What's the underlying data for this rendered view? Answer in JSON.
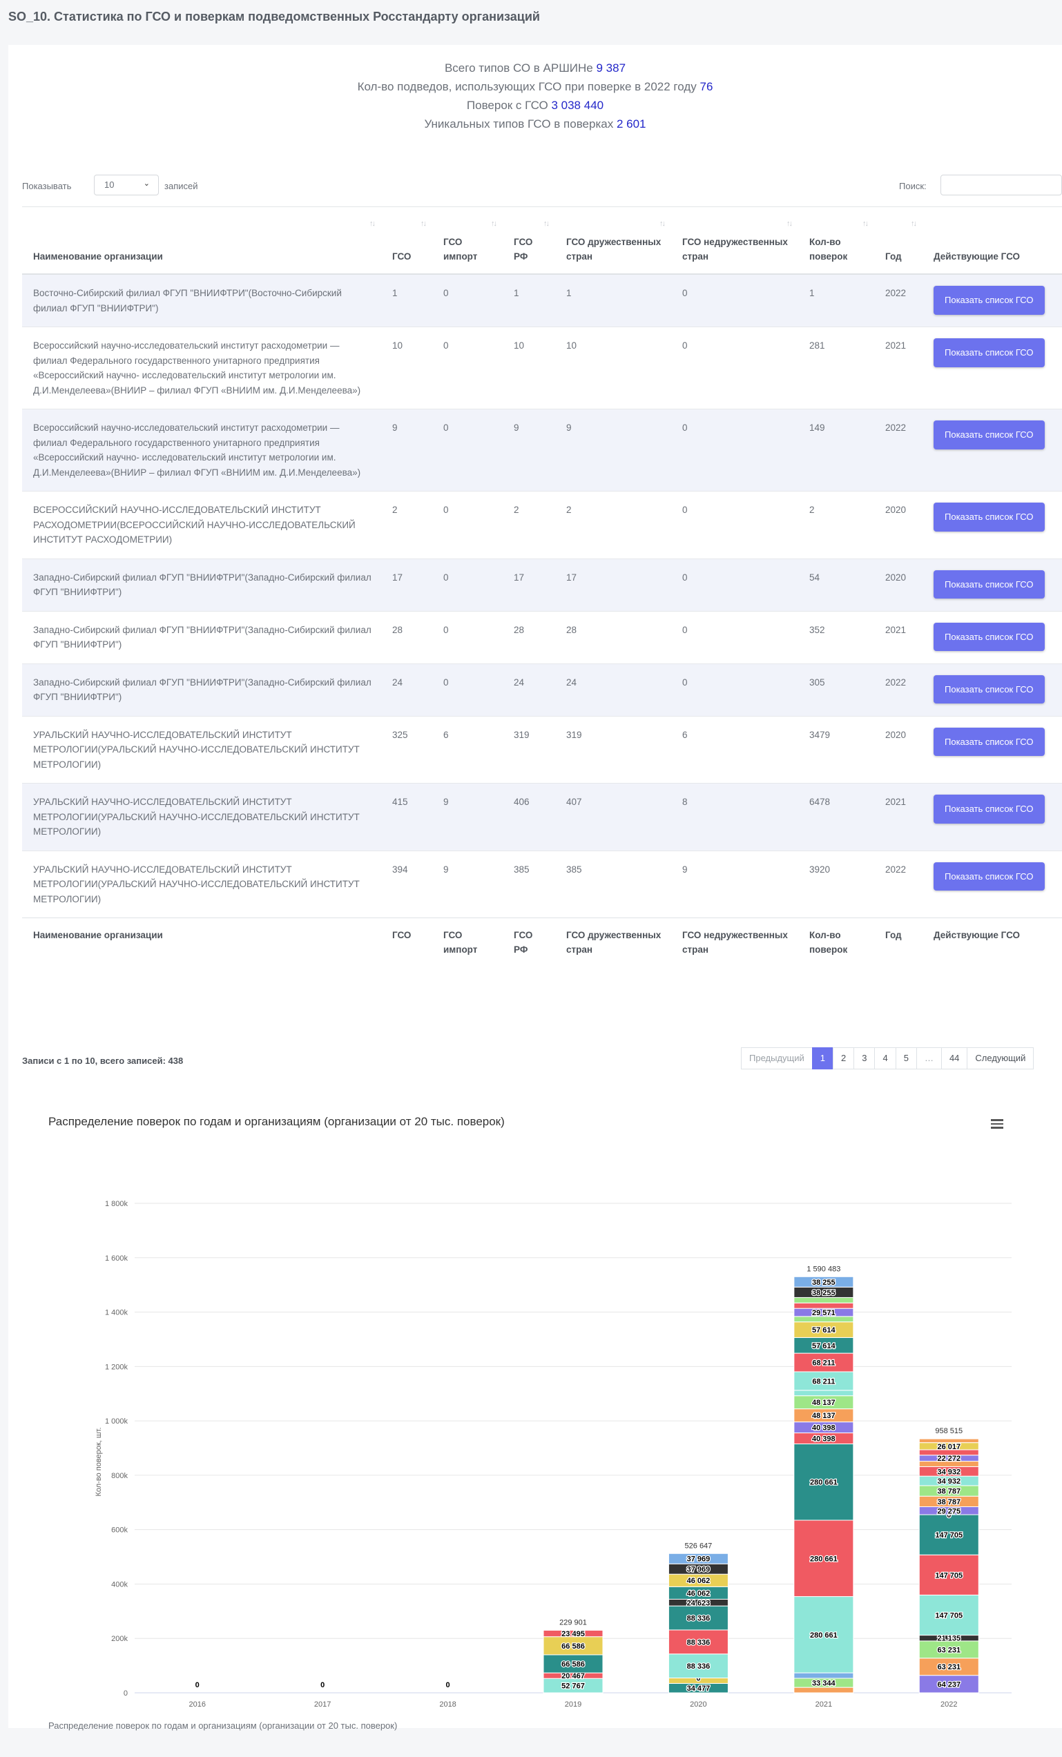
{
  "page": {
    "title": "SO_10. Статистика по ГСО и поверкам подведомственных Росстандарту организаций"
  },
  "summary": [
    {
      "label": "Всего типов СО в АРШИНе",
      "value": "9 387"
    },
    {
      "label": "Кол-во подведов, использующих ГСО при поверке в 2022 году",
      "value": "76"
    },
    {
      "label": "Поверок с ГСО",
      "value": "3 038 440"
    },
    {
      "label": "Уникальных типов ГСО в поверках",
      "value": "2 601"
    }
  ],
  "controls": {
    "show_label": "Показывать",
    "page_size": "10",
    "records_label": "записей",
    "search_label": "Поиск:",
    "search_value": ""
  },
  "table": {
    "columns": [
      "Наименование организации",
      "ГСО",
      "ГСО импорт",
      "ГСО РФ",
      "ГСО дружественных стран",
      "ГСО недружественных стран",
      "Кол-во поверок",
      "Год",
      "Действующие ГСО"
    ],
    "button_label": "Показать список ГСО",
    "rows": [
      {
        "org": "Восточно-Сибирский филиал ФГУП \"ВНИИФТРИ\"(Восточно-Сибирский филиал ФГУП \"ВНИИФТРИ\")",
        "gso": "1",
        "imp": "0",
        "rf": "1",
        "friendly": "1",
        "unfriendly": "0",
        "checks": "1",
        "year": "2022"
      },
      {
        "org": "Всероссийский научно-исследовательский институт расходометрии — филиал Федерального государственного унитарного предприятия «Всероссийский научно- исследовательский институт метрологии им. Д.И.Менделеева»(ВНИИР – филиал ФГУП «ВНИИМ им. Д.И.Менделеева»)",
        "gso": "10",
        "imp": "0",
        "rf": "10",
        "friendly": "10",
        "unfriendly": "0",
        "checks": "281",
        "year": "2021"
      },
      {
        "org": "Всероссийский научно-исследовательский институт расходометрии — филиал Федерального государственного унитарного предприятия «Всероссийский научно- исследовательский институт метрологии им. Д.И.Менделеева»(ВНИИР – филиал ФГУП «ВНИИМ им. Д.И.Менделеева»)",
        "gso": "9",
        "imp": "0",
        "rf": "9",
        "friendly": "9",
        "unfriendly": "0",
        "checks": "149",
        "year": "2022"
      },
      {
        "org": "ВСЕРОССИЙСКИЙ НАУЧНО-ИССЛЕДОВАТЕЛЬСКИЙ ИНСТИТУТ РАСХОДОМЕТРИИ(ВСЕРОССИЙСКИЙ НАУЧНО-ИССЛЕДОВАТЕЛЬСКИЙ ИНСТИТУТ РАСХОДОМЕТРИИ)",
        "gso": "2",
        "imp": "0",
        "rf": "2",
        "friendly": "2",
        "unfriendly": "0",
        "checks": "2",
        "year": "2020"
      },
      {
        "org": "Западно-Сибирский филиал ФГУП \"ВНИИФТРИ\"(Западно-Сибирский филиал ФГУП \"ВНИИФТРИ\")",
        "gso": "17",
        "imp": "0",
        "rf": "17",
        "friendly": "17",
        "unfriendly": "0",
        "checks": "54",
        "year": "2020"
      },
      {
        "org": "Западно-Сибирский филиал ФГУП \"ВНИИФТРИ\"(Западно-Сибирский филиал ФГУП \"ВНИИФТРИ\")",
        "gso": "28",
        "imp": "0",
        "rf": "28",
        "friendly": "28",
        "unfriendly": "0",
        "checks": "352",
        "year": "2021"
      },
      {
        "org": "Западно-Сибирский филиал ФГУП \"ВНИИФТРИ\"(Западно-Сибирский филиал ФГУП \"ВНИИФТРИ\")",
        "gso": "24",
        "imp": "0",
        "rf": "24",
        "friendly": "24",
        "unfriendly": "0",
        "checks": "305",
        "year": "2022"
      },
      {
        "org": "УРАЛЬСКИЙ НАУЧНО-ИССЛЕДОВАТЕЛЬСКИЙ ИНСТИТУТ МЕТРОЛОГИИ(УРАЛЬСКИЙ НАУЧНО-ИССЛЕДОВАТЕЛЬСКИЙ ИНСТИТУТ МЕТРОЛОГИИ)",
        "gso": "325",
        "imp": "6",
        "rf": "319",
        "friendly": "319",
        "unfriendly": "6",
        "checks": "3479",
        "year": "2020"
      },
      {
        "org": "УРАЛЬСКИЙ НАУЧНО-ИССЛЕДОВАТЕЛЬСКИЙ ИНСТИТУТ МЕТРОЛОГИИ(УРАЛЬСКИЙ НАУЧНО-ИССЛЕДОВАТЕЛЬСКИЙ ИНСТИТУТ МЕТРОЛОГИИ)",
        "gso": "415",
        "imp": "9",
        "rf": "406",
        "friendly": "407",
        "unfriendly": "8",
        "checks": "6478",
        "year": "2021"
      },
      {
        "org": "УРАЛЬСКИЙ НАУЧНО-ИССЛЕДОВАТЕЛЬСКИЙ ИНСТИТУТ МЕТРОЛОГИИ(УРАЛЬСКИЙ НАУЧНО-ИССЛЕДОВАТЕЛЬСКИЙ ИНСТИТУТ МЕТРОЛОГИИ)",
        "gso": "394",
        "imp": "9",
        "rf": "385",
        "friendly": "385",
        "unfriendly": "9",
        "checks": "3920",
        "year": "2022"
      }
    ]
  },
  "pagination": {
    "info": "Записи с 1 по 10, всего записей: 438",
    "items": [
      "Предыдущий",
      "1",
      "2",
      "3",
      "4",
      "5",
      "…",
      "44",
      "Следующий"
    ],
    "active": "1"
  },
  "chart_data": {
    "type": "bar",
    "stacked": true,
    "title": "Распределение поверок по годам и организациям (организации от 20 тыс. поверок)",
    "caption": "Распределение поверок по годам и организациям (организации от 20 тыс. поверок)",
    "ylabel": "Кол-во поверок, шт.",
    "xlabel": "",
    "categories": [
      "2016",
      "2017",
      "2018",
      "2019",
      "2020",
      "2021",
      "2022"
    ],
    "ylim": [
      0,
      1800000
    ],
    "yticks": [
      "0",
      "200k",
      "400k",
      "600k",
      "800k",
      "1 000k",
      "1 200k",
      "1 400k",
      "1 600k",
      "1 800k"
    ],
    "totals": [
      "0",
      "0",
      "0",
      "229 901",
      "526 647",
      "1 590 483",
      "958 515"
    ],
    "stacks": {
      "2019": [
        {
          "value": 52767,
          "label": "52 767",
          "color": "#8ee6d8"
        },
        {
          "value": 20467,
          "label": "20 467",
          "color": "#f05a62"
        },
        {
          "value": 66586,
          "label": "66 586",
          "color": "#2a8f8a"
        },
        {
          "value": 66586,
          "label": "66 586",
          "color": "#e8cf55"
        },
        {
          "value": 23495,
          "label": "23 495",
          "color": "#f05a62"
        }
      ],
      "2020": [
        {
          "value": 34477,
          "label": "34 477",
          "color": "#2a8f8a"
        },
        {
          "value": 20000,
          "label": "",
          "color": "#e8cf55"
        },
        {
          "value": 0,
          "label": "0",
          "color": "#f6a05a"
        },
        {
          "value": 88336,
          "label": "88 336",
          "color": "#8ee6d8"
        },
        {
          "value": 88336,
          "label": "88 336",
          "color": "#f05a62"
        },
        {
          "value": 88336,
          "label": "88 336",
          "color": "#2a8f8a"
        },
        {
          "value": 24623,
          "label": "24 623",
          "color": "#333333"
        },
        {
          "value": 46062,
          "label": "46 062",
          "color": "#2a8f8a"
        },
        {
          "value": 46062,
          "label": "46 062",
          "color": "#e8cf55"
        },
        {
          "value": 37969,
          "label": "37 969",
          "color": "#333333"
        },
        {
          "value": 37969,
          "label": "37 969",
          "color": "#7aaee6"
        }
      ],
      "2021": [
        {
          "value": 20000,
          "label": "",
          "color": "#f6a05a"
        },
        {
          "value": 33344,
          "label": "33 344",
          "color": "#9ee687"
        },
        {
          "value": 20000,
          "label": "",
          "color": "#7aaee6"
        },
        {
          "value": 280661,
          "label": "280 661",
          "color": "#8ee6d8"
        },
        {
          "value": 280661,
          "label": "280 661",
          "color": "#f05a62"
        },
        {
          "value": 280661,
          "label": "280 661",
          "color": "#2a8f8a"
        },
        {
          "value": 40398,
          "label": "40 398",
          "color": "#f05a62"
        },
        {
          "value": 40398,
          "label": "40 398",
          "color": "#8a7ae6"
        },
        {
          "value": 48137,
          "label": "48 137",
          "color": "#f6a05a"
        },
        {
          "value": 48137,
          "label": "48 137",
          "color": "#9ee687"
        },
        {
          "value": 20000,
          "label": "",
          "color": "#8ee6d8"
        },
        {
          "value": 68211,
          "label": "68 211",
          "color": "#8ee6d8"
        },
        {
          "value": 68211,
          "label": "68 211",
          "color": "#f05a62"
        },
        {
          "value": 57614,
          "label": "57 614",
          "color": "#2a8f8a"
        },
        {
          "value": 57614,
          "label": "57 614",
          "color": "#e8cf55"
        },
        {
          "value": 20000,
          "label": "",
          "color": "#9ee687"
        },
        {
          "value": 29571,
          "label": "29 571",
          "color": "#8a7ae6"
        },
        {
          "value": 20000,
          "label": "",
          "color": "#f05a62"
        },
        {
          "value": 20000,
          "label": "",
          "color": "#9ee687"
        },
        {
          "value": 38255,
          "label": "38 255",
          "color": "#333333"
        },
        {
          "value": 38255,
          "label": "38 255",
          "color": "#7aaee6"
        }
      ],
      "2022": [
        {
          "value": 64237,
          "label": "64 237",
          "color": "#8a7ae6"
        },
        {
          "value": 63231,
          "label": "63 231",
          "color": "#f6a05a"
        },
        {
          "value": 63231,
          "label": "63 231",
          "color": "#9ee687"
        },
        {
          "value": 21135,
          "label": "21 135",
          "color": "#333333"
        },
        {
          "value": 147705,
          "label": "147 705",
          "color": "#8ee6d8"
        },
        {
          "value": 147705,
          "label": "147 705",
          "color": "#f05a62"
        },
        {
          "value": 147705,
          "label": "147 705",
          "color": "#2a8f8a"
        },
        {
          "value": 0,
          "label": "0",
          "color": "#f05a62"
        },
        {
          "value": 29275,
          "label": "29 275",
          "color": "#8a7ae6"
        },
        {
          "value": 38787,
          "label": "38 787",
          "color": "#f6a05a"
        },
        {
          "value": 38787,
          "label": "38 787",
          "color": "#9ee687"
        },
        {
          "value": 34932,
          "label": "34 932",
          "color": "#8ee6d8"
        },
        {
          "value": 34932,
          "label": "34 932",
          "color": "#f05a62"
        },
        {
          "value": 20000,
          "label": "",
          "color": "#f6a05a"
        },
        {
          "value": 22272,
          "label": "22 272",
          "color": "#8a7ae6"
        },
        {
          "value": 20000,
          "label": "",
          "color": "#f05a62"
        },
        {
          "value": 26017,
          "label": "26 017",
          "color": "#e8cf55"
        },
        {
          "value": 14000,
          "label": "",
          "color": "#f6a05a"
        }
      ]
    },
    "grid": true,
    "legend": "none"
  }
}
